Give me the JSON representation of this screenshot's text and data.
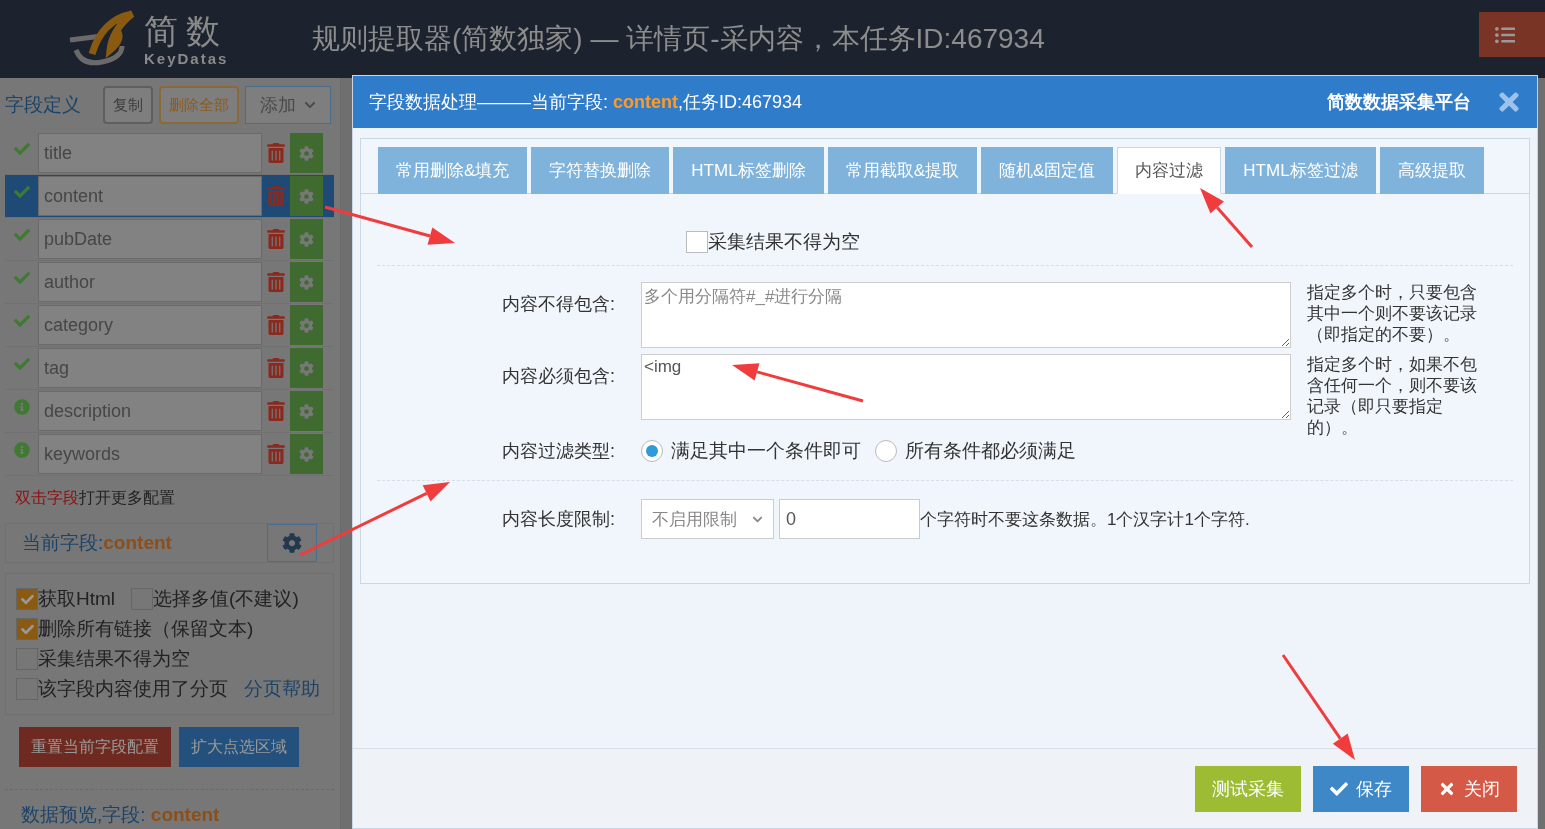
{
  "header": {
    "logo_text": "简数",
    "logo_subtext": "KeyDatas",
    "title": "规则提取器(简数独家) — 详情页-采内容，本任务ID:467934"
  },
  "sidebar": {
    "toolbar": {
      "label": "字段定义",
      "buttons": [
        {
          "label": "复制",
          "kind": "plain"
        },
        {
          "label": "删除全部",
          "kind": "warning"
        },
        {
          "label": "添加",
          "kind": "dropdown"
        }
      ]
    },
    "fields": [
      {
        "name": "title",
        "kind": "check",
        "selected": false
      },
      {
        "name": "content",
        "kind": "check",
        "selected": true
      },
      {
        "name": "pubDate",
        "kind": "check",
        "selected": false
      },
      {
        "name": "author",
        "kind": "check",
        "selected": false
      },
      {
        "name": "category",
        "kind": "check",
        "selected": false
      },
      {
        "name": "tag",
        "kind": "check",
        "selected": false
      },
      {
        "name": "description",
        "kind": "info",
        "selected": false
      },
      {
        "name": "keywords",
        "kind": "info",
        "selected": false
      }
    ],
    "hint": {
      "emphasis": "双击字段",
      "rest": "打开更多配置"
    },
    "current_field": {
      "label": "当前字段:",
      "value": "content"
    },
    "option_rows": [
      [
        {
          "label": "获取Html",
          "checked": true
        },
        {
          "label": "选择多值(不建议)",
          "checked": false
        }
      ],
      [
        {
          "label": "删除所有链接（保留文本)",
          "checked": true
        }
      ],
      [
        {
          "label": "采集结果不得为空",
          "checked": false
        }
      ],
      [
        {
          "label": "该字段内容使用了分页",
          "checked": false
        }
      ]
    ],
    "help_link": "分页帮助",
    "actions": [
      {
        "label": "重置当前字段配置",
        "kind": "danger"
      },
      {
        "label": "扩大点选区域",
        "kind": "primary"
      }
    ],
    "preview": {
      "label": "数据预览,字段:",
      "value": "content"
    }
  },
  "modal": {
    "title": {
      "prefix": "字段数据处理———当前字段: ",
      "field": "content",
      "suffix": ",任务ID:467934"
    },
    "brand": "简数数据采集平台",
    "tabs": [
      {
        "label": "常用删除&填充",
        "selected": false
      },
      {
        "label": "字符替换删除",
        "selected": false
      },
      {
        "label": "HTML标签删除",
        "selected": false
      },
      {
        "label": "常用截取&提取",
        "selected": false
      },
      {
        "label": "随机&固定值",
        "selected": false
      },
      {
        "label": "内容过滤",
        "selected": true
      },
      {
        "label": "HTML标签过滤",
        "selected": false
      },
      {
        "label": "高级提取",
        "selected": false
      }
    ],
    "not_empty": {
      "label": "采集结果不得为空",
      "checked": false
    },
    "text_fields": [
      {
        "label": "内容不得包含:",
        "placeholder": "多个用分隔符#_#进行分隔",
        "note": "指定多个时，只要包含其中一个则不要该记录（即指定的不要）。"
      },
      {
        "label": "内容必须包含:",
        "value": "<img",
        "note": "指定多个时，如果不包含任何一个，则不要该记录（即只要指定的）。"
      }
    ],
    "filter_type": {
      "label": "内容过滤类型:",
      "options": [
        {
          "label": "满足其中一个条件即可",
          "selected": true
        },
        {
          "label": "所有条件都必须满足",
          "selected": false
        }
      ]
    },
    "length_limit": {
      "label": "内容长度限制:",
      "select": "不启用限制",
      "value": "0",
      "suffix": "个字符时不要这条数据。1个汉字计1个字符."
    },
    "buttons": [
      {
        "label": "测试采集",
        "kind": "success"
      },
      {
        "label": "保存",
        "kind": "save"
      },
      {
        "label": "关闭",
        "kind": "close"
      }
    ]
  }
}
